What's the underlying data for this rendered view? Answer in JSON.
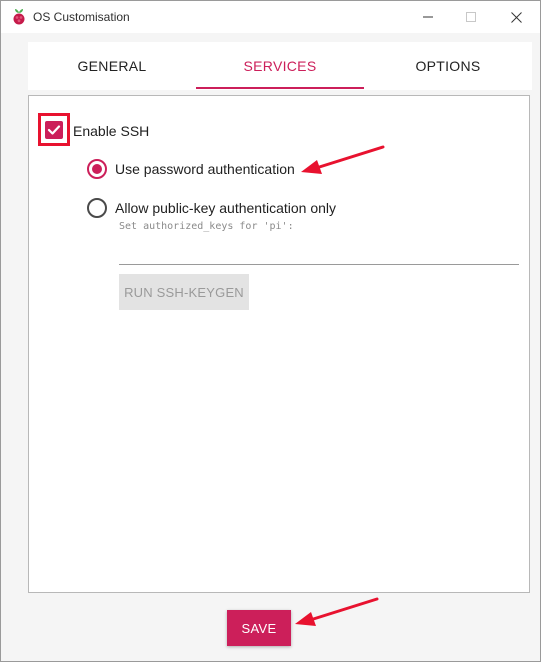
{
  "window": {
    "title": "OS Customisation"
  },
  "tabs": [
    {
      "label": "GENERAL",
      "active": false
    },
    {
      "label": "SERVICES",
      "active": true
    },
    {
      "label": "OPTIONS",
      "active": false
    }
  ],
  "services": {
    "enable_ssh": {
      "label": "Enable SSH",
      "checked": true
    },
    "auth_options": [
      {
        "label": "Use password authentication",
        "selected": true
      },
      {
        "label": "Allow public-key authentication only",
        "selected": false
      }
    ],
    "authorized_keys_hint": "Set authorized_keys for 'pi':",
    "authorized_keys_value": "",
    "keygen_label": "RUN SSH-KEYGEN"
  },
  "footer": {
    "save_label": "SAVE"
  },
  "colors": {
    "accent": "#cc1f5a",
    "annotation": "#e8122f"
  },
  "icons": [
    "raspberry-pi-icon",
    "minimize-icon",
    "maximize-icon",
    "close-icon",
    "checkmark-icon",
    "arrow-annotation-icon"
  ]
}
